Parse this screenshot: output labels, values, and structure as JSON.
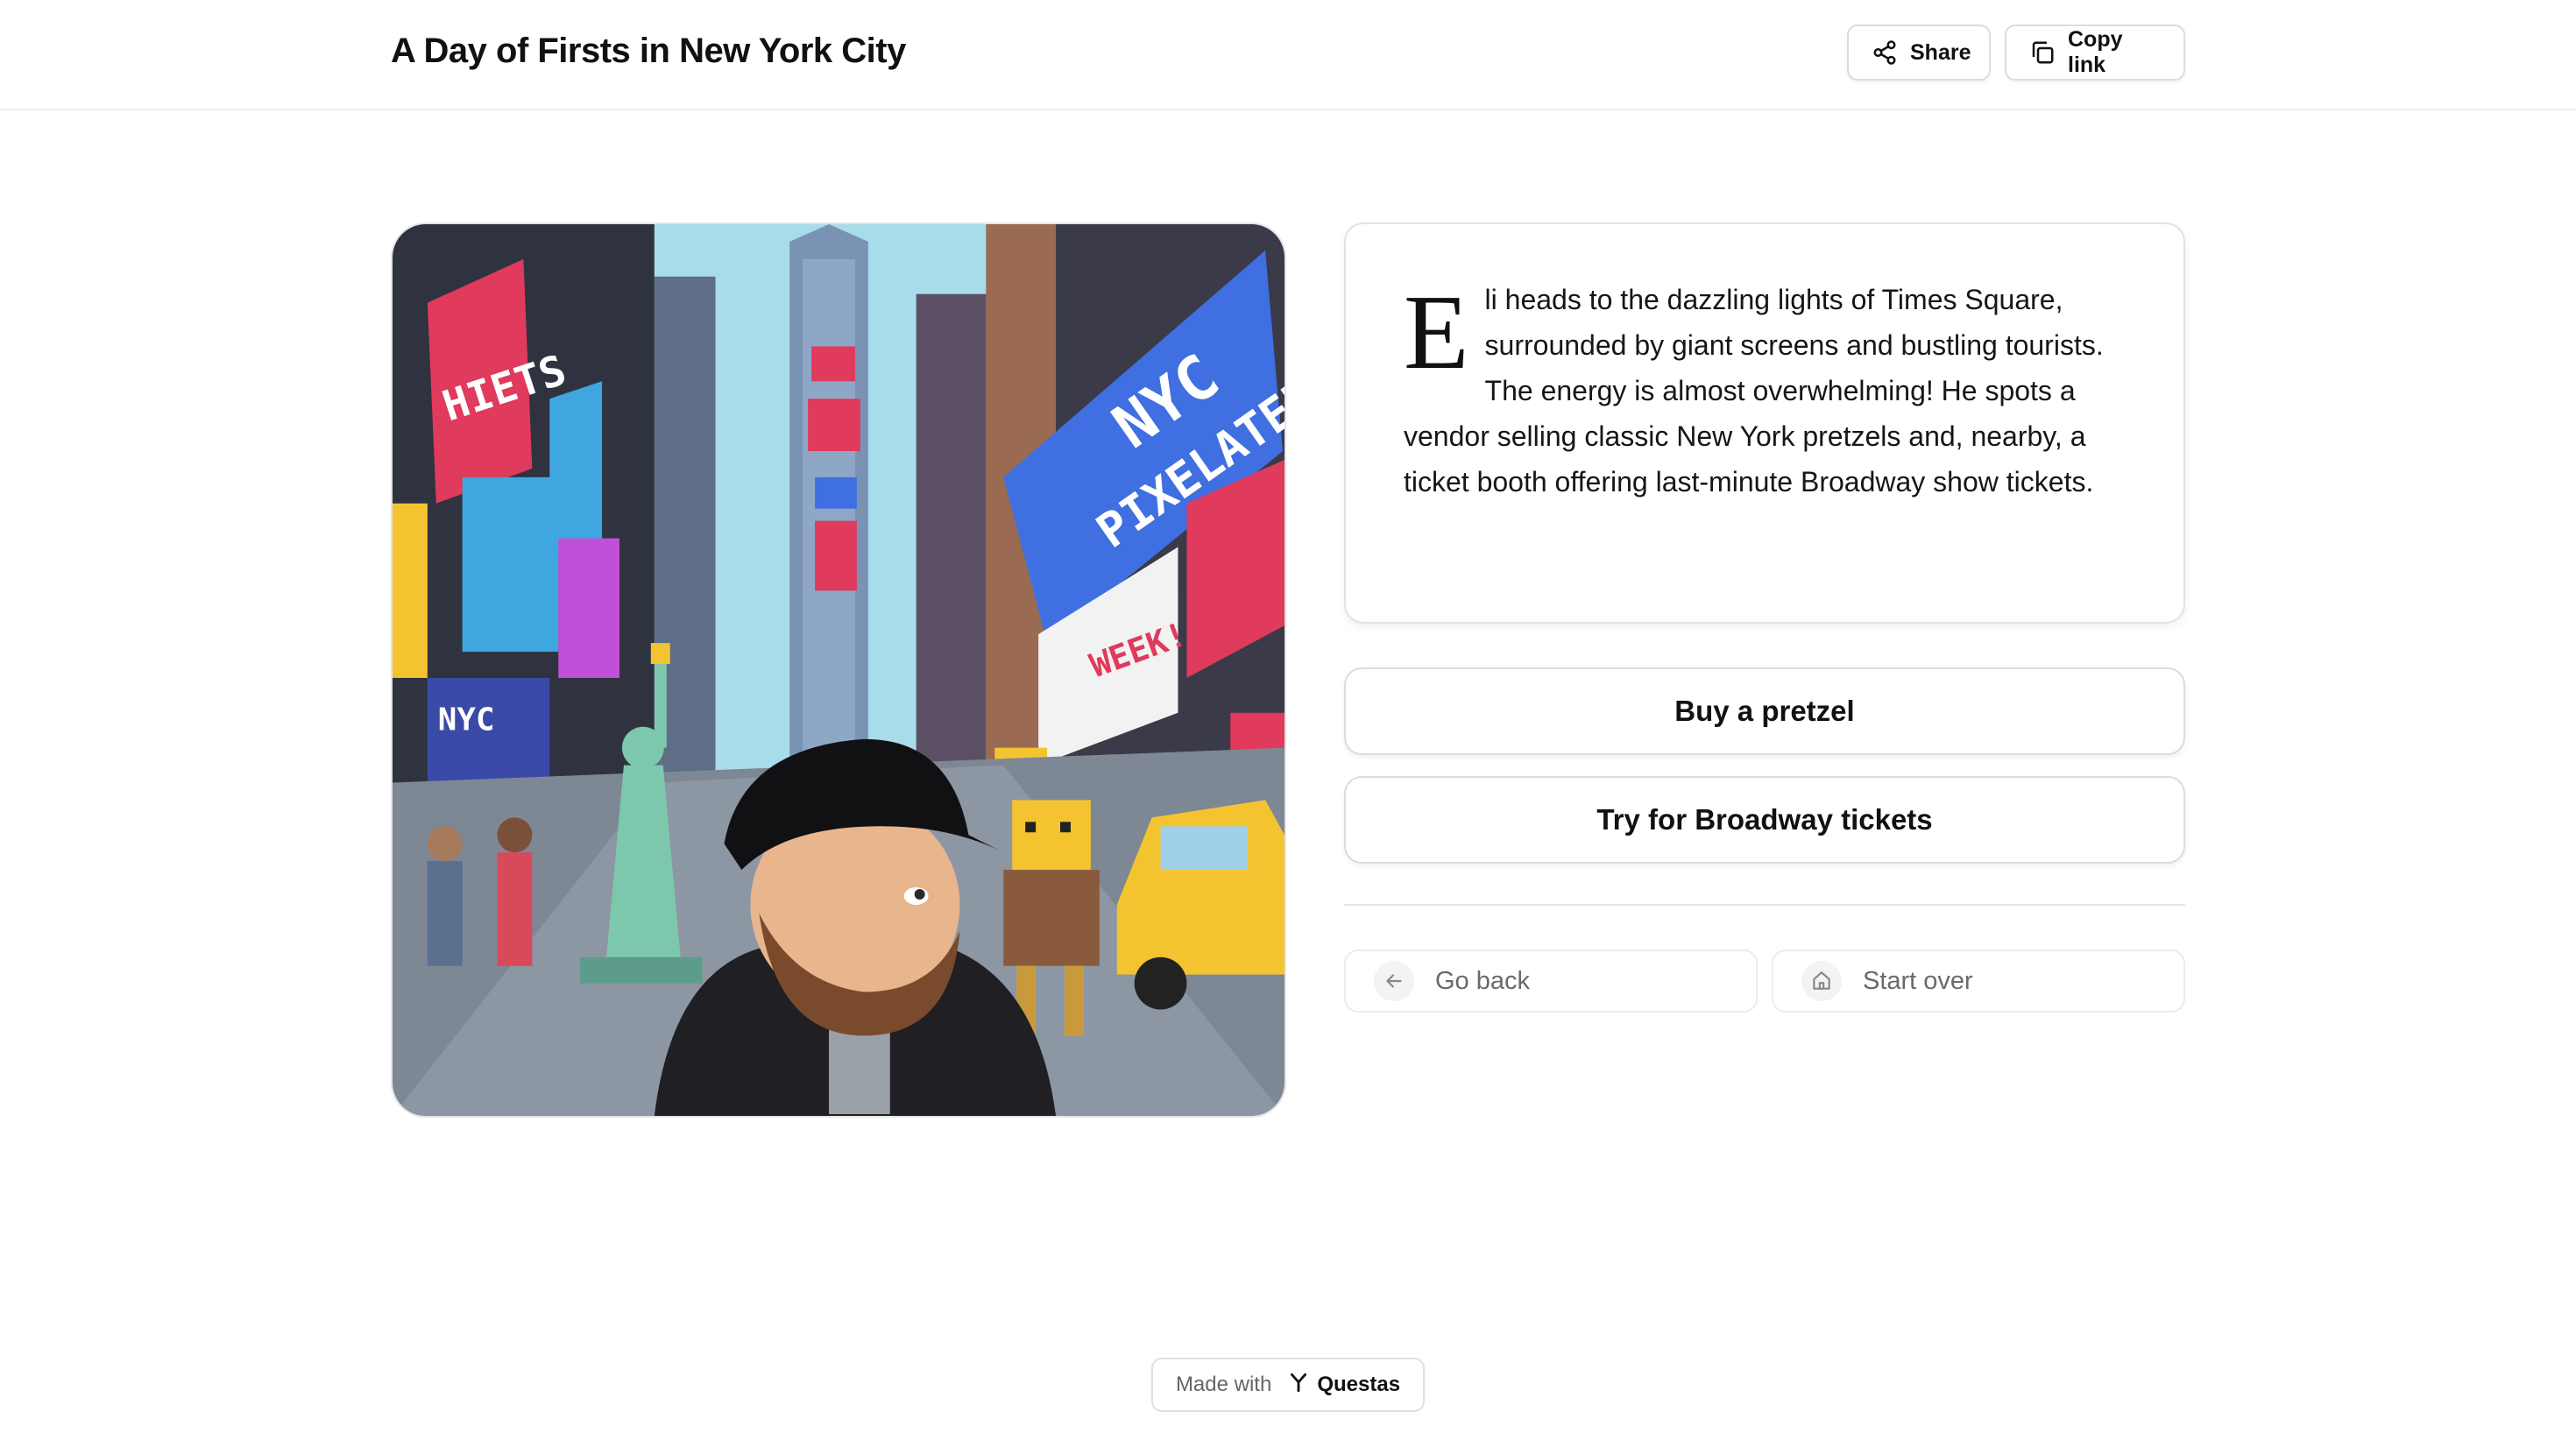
{
  "header": {
    "title": "A Day of Firsts in New York City",
    "share_label": "Share",
    "copy_link_label": "Copy link"
  },
  "story": {
    "drop_cap": "E",
    "text": "li heads to the dazzling lights of Times Square, surrounded by giant screens and bustling tourists. The energy is almost overwhelming! He spots a vendor selling classic New York pretzels and, nearby, a ticket booth offering last-minute Broadway show tickets."
  },
  "choices": [
    {
      "label": "Buy a pretzel"
    },
    {
      "label": "Try for Broadway tickets"
    }
  ],
  "navigation": {
    "back_label": "Go back",
    "start_over_label": "Start over"
  },
  "footer": {
    "made_with": "Made with",
    "brand": "Questas"
  },
  "scene": {
    "billboard_texts": [
      "HIETS",
      "NYC",
      "PIXELATED!",
      "NYC",
      "WEEK!"
    ]
  },
  "colors": {
    "text": "#111111",
    "muted": "#6a6a6a",
    "border": "#dcdcdc",
    "sky": "#a9dcea",
    "billboard_blue": "#3f6fe0",
    "billboard_red": "#e03a5c",
    "taxi_yellow": "#f4c430"
  },
  "icons": {
    "share": "share-icon",
    "copy": "copy-icon",
    "back": "arrow-left-icon",
    "home": "home-icon",
    "brand": "questas-logo-icon"
  }
}
